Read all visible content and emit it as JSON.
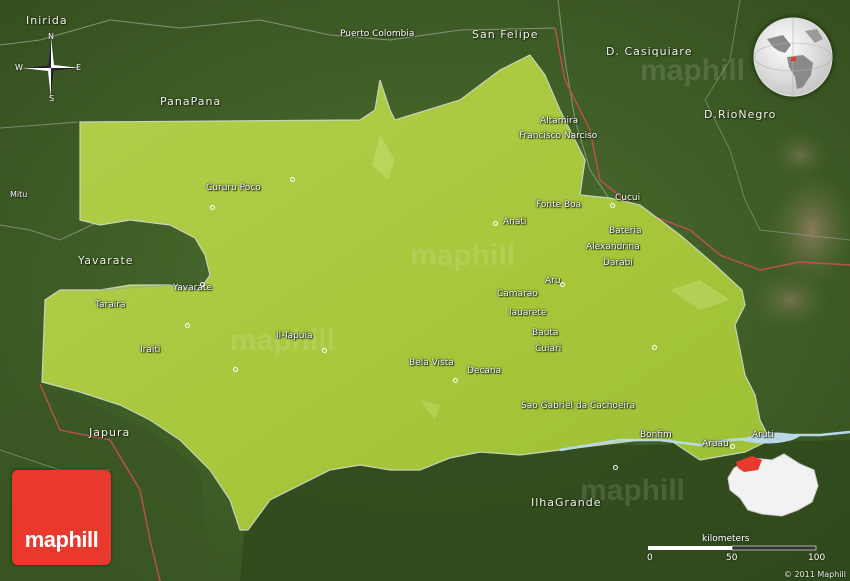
{
  "brand": {
    "name": "maphill",
    "copyright": "© 2011 Maphill"
  },
  "compass": {
    "n": "N",
    "s": "S",
    "e": "E",
    "w": "W"
  },
  "scale": {
    "unit": "kilometers",
    "ticks": [
      "0",
      "50",
      "100"
    ]
  },
  "colors": {
    "region": "#a8c83c",
    "surroundings": "#466a2a",
    "river": "#b8d8e8",
    "border": "#b85050",
    "logo": "#e8392c"
  },
  "labels": {
    "inirida": "Inirida",
    "puerto_colombia": "Puerto Colombia",
    "san_felipe": "San Felipe",
    "d_casiquiare": "D. Casiquiare",
    "panapana": "PanaPana",
    "d_rionegro": "D.RioNegro",
    "altamira": "Altamira",
    "francisco_narciso": "Francisco Narciso",
    "mitu": "Mitu",
    "cururu_poco": "Cururu Poco",
    "fonte_boa": "Fonte Boa",
    "cucui": "Cucui",
    "anati": "Anati",
    "bateria": "Bateria",
    "alexandrina": "Alexandrina",
    "darabi": "Darabi",
    "yavarate_region": "Yavarate",
    "yavarate_town": "Yavarate",
    "aru": "Aru",
    "camarao": "Camarao",
    "taraira": "Taraira",
    "iauarete": "Iauarete",
    "il_tapuia": "Il-Tapuia",
    "bauta": "Bauta",
    "iraiti": "Iraiti",
    "cuiari": "Cuiari",
    "bela_vista": "Bela Vista",
    "decana": "Decana",
    "sao_gabriel": "Sao Gabriel da Cachoeira",
    "japura": "Japura",
    "bonfim": "Bonfim",
    "aruau": "Aruau",
    "aruti": "Aruti",
    "ilha_grande": "IlhaGrande"
  }
}
